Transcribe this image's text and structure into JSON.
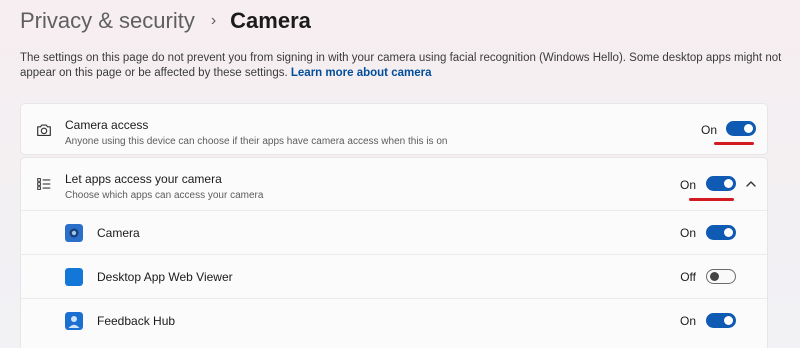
{
  "breadcrumb": {
    "parent": "Privacy & security",
    "separator": "›",
    "current": "Camera"
  },
  "description": {
    "text": "The settings on this page do not prevent you from signing in with your camera using facial recognition (Windows Hello). Some desktop apps might not appear on this page or be affected by these settings.",
    "link_label": "Learn more about camera"
  },
  "camera_access": {
    "title": "Camera access",
    "subtitle": "Anyone using this device can choose if their apps have camera access when this is on",
    "state_label": "On",
    "enabled": true,
    "icon": "camera-icon"
  },
  "apps_access": {
    "title": "Let apps access your camera",
    "subtitle": "Choose which apps can access your camera",
    "state_label": "On",
    "enabled": true,
    "icon": "list-icon",
    "expanded": true
  },
  "apps": [
    {
      "name": "Camera",
      "state_label": "On",
      "enabled": true,
      "icon": "camera-app-icon"
    },
    {
      "name": "Desktop App Web Viewer",
      "state_label": "Off",
      "enabled": false,
      "icon": "web-viewer-app-icon"
    },
    {
      "name": "Feedback Hub",
      "state_label": "On",
      "enabled": true,
      "icon": "feedback-hub-app-icon"
    }
  ],
  "colors": {
    "accent": "#0f5bb4",
    "link": "#004e9b",
    "annotation": "#d21a22"
  }
}
